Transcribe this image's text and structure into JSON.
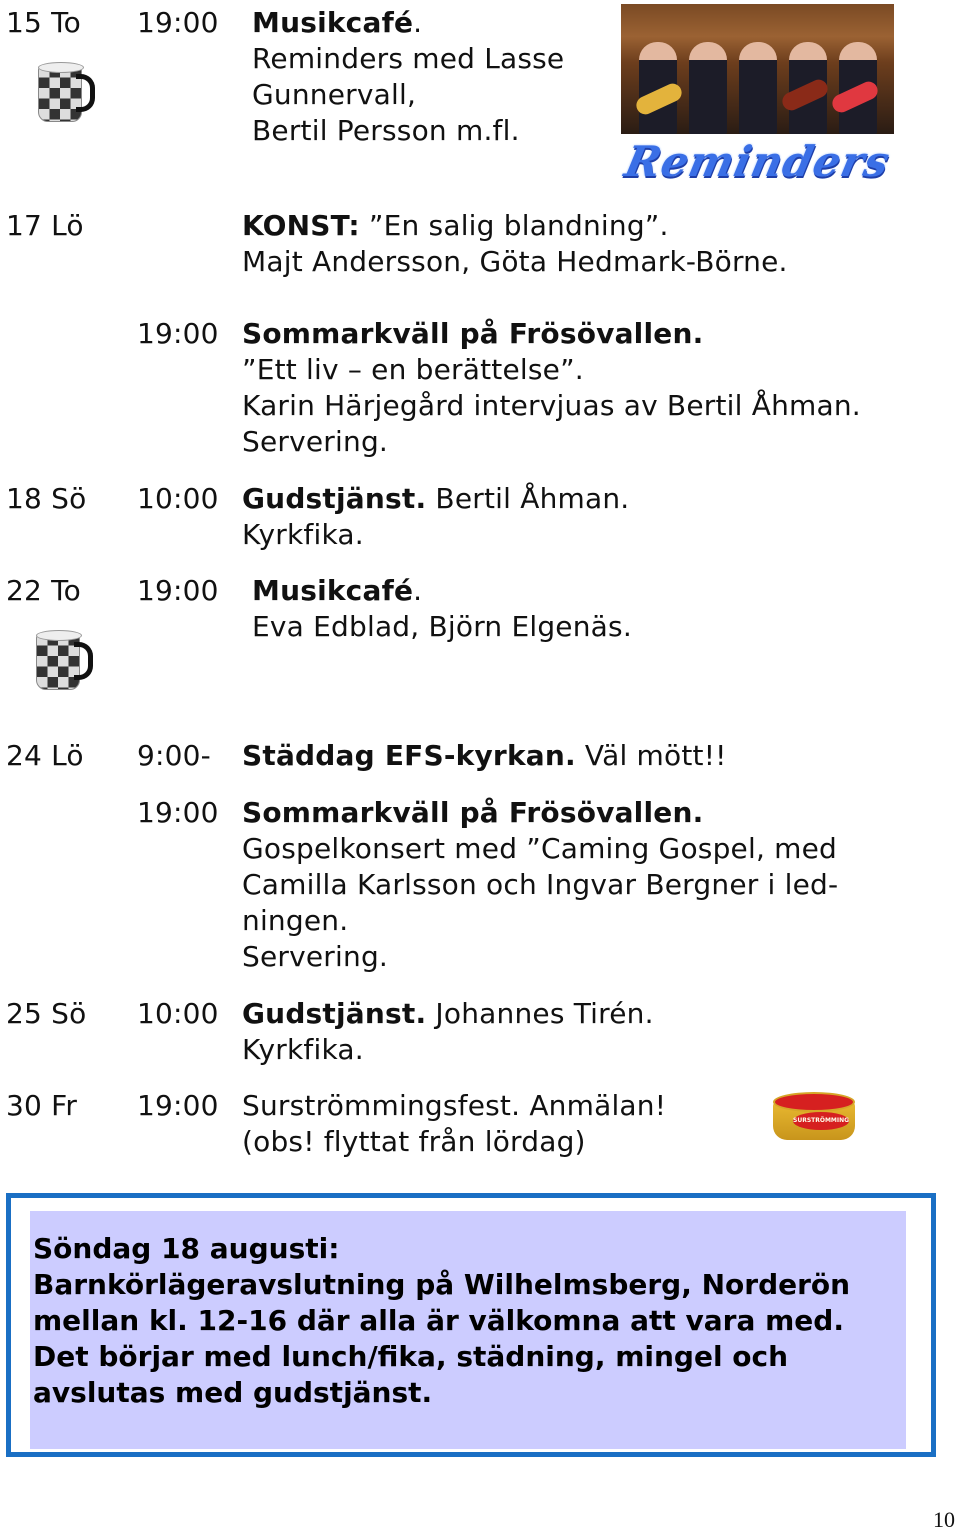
{
  "events": [
    {
      "day": "15 To",
      "time": "19:00",
      "title": "Musikcafé",
      "title_suffix": ".",
      "lines": [
        "Reminders med Lasse",
        "Gunnervall,",
        "Bertil Persson m.fl."
      ],
      "icon": "coffee-mug-icon"
    },
    {
      "day": "17 Lö",
      "time": "",
      "title": "KONST:",
      "title_rest": " ”En salig blandning”.",
      "lines": [
        "Majt Andersson, Göta Hedmark-Börne."
      ]
    },
    {
      "day": "",
      "time": "19:00",
      "title": "Sommarkväll på Frösövallen.",
      "lines": [
        "”Ett liv – en berättelse”.",
        "Karin Härjegård intervjuas av Bertil Åhman.",
        "Servering."
      ]
    },
    {
      "day": "18 Sö",
      "time": "10:00",
      "title": "Gudstjänst.",
      "title_rest": " Bertil Åhman.",
      "lines": [
        "Kyrkfika."
      ]
    },
    {
      "day": "22 To",
      "time": "19:00",
      "title": "Musikcafé",
      "title_suffix": ".",
      "lines": [
        "Eva Edblad, Björn Elgenäs."
      ],
      "icon": "coffee-mug-icon"
    },
    {
      "day": "24 Lö",
      "time": "9:00-",
      "title": "Städdag EFS-kyrkan.",
      "title_rest": " Väl mött!!",
      "lines": []
    },
    {
      "day": "",
      "time": "19:00",
      "title": "Sommarkväll på Frösövallen.",
      "lines": [
        "Gospelkonsert med ”Caming Gospel, med",
        "Camilla Karlsson och Ingvar Bergner i led-",
        "ningen.",
        "Servering."
      ]
    },
    {
      "day": "25 Sö",
      "time": "10:00",
      "title": "Gudstjänst.",
      "title_rest": " Johannes Tirén.",
      "lines": [
        "Kyrkfika."
      ]
    },
    {
      "day": "30 Fr",
      "time": "19:00",
      "title": "",
      "title_rest": "Surströmmingsfest. Anmälan!",
      "lines": [
        "(obs! flyttat från lördag)"
      ],
      "icon": "surstromming-can-icon"
    }
  ],
  "band_image": {
    "logo_text": "Reminders",
    "alt": "Reminders band photo"
  },
  "can_label": "SURSTRÖMMING",
  "notice": {
    "lines": [
      "Söndag 18 augusti:",
      "Barnkörlägeravslutning på Wilhelmsberg, Norderön",
      "mellan kl. 12-16 där alla är välkomna att vara med.",
      "Det börjar med lunch/fika, städning, mingel och",
      "avslutas med gudstjänst."
    ],
    "border_color": "#1a6fc4",
    "background_color": "#ccccff"
  },
  "page_number": "10"
}
